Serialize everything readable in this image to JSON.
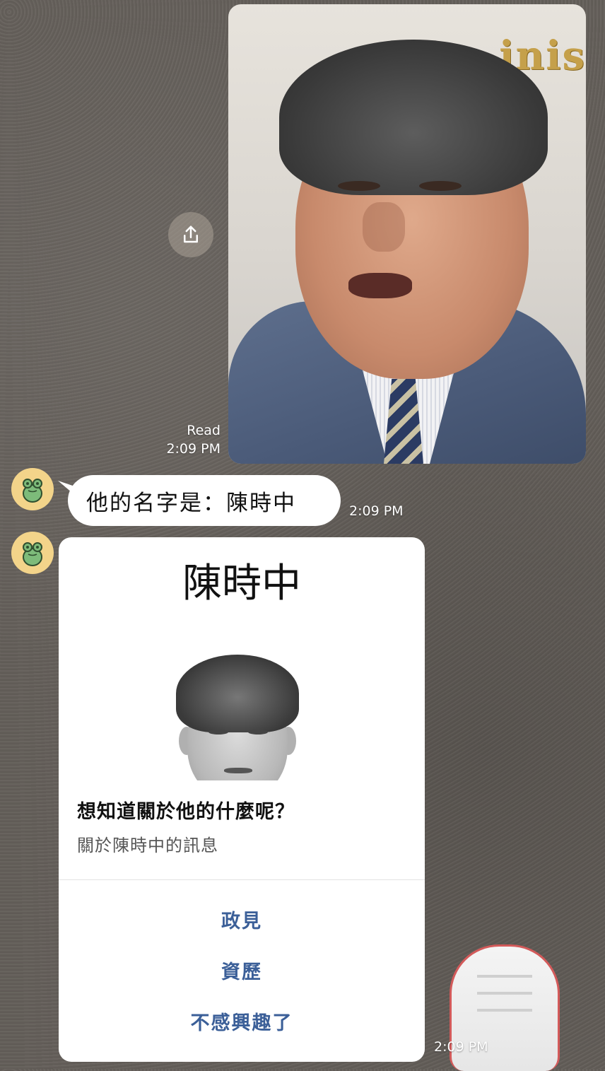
{
  "outgoing_image": {
    "wall_text": "inis",
    "read_label": "Read",
    "time": "2:09 PM"
  },
  "bot_text_message": {
    "text": "他的名字是：陳時中",
    "time": "2:09 PM"
  },
  "profile_card": {
    "title": "陳時中",
    "question": "想知道關於他的什麼呢？",
    "subtitle": "關於陳時中的訊息",
    "actions": [
      "政見",
      "資歷",
      "不感興趣了"
    ],
    "time": "2:09 PM"
  },
  "colors": {
    "action_text": "#3b5f98",
    "avatar_bg": "#f3d48a",
    "bubble_bg": "#ffffff"
  },
  "icons": [
    "share-icon",
    "frog-avatar-icon"
  ]
}
